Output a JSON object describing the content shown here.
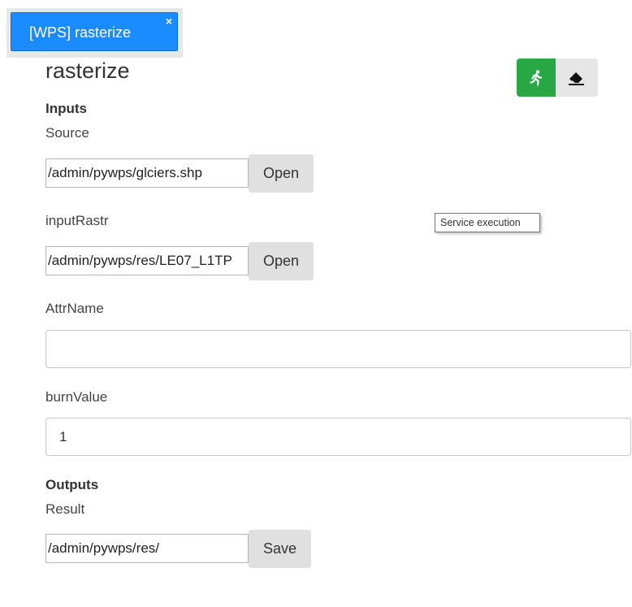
{
  "tab": {
    "label": "[WPS] rasterize",
    "close": "×"
  },
  "title": "rasterize",
  "actions": {
    "run_icon": "running-person-icon",
    "clear_icon": "eraser-icon",
    "tooltip": "Service execution"
  },
  "inputs": {
    "heading": "Inputs",
    "source": {
      "label": "Source",
      "value": "/admin/pywps/glciers.shp",
      "button": "Open"
    },
    "inputRastr": {
      "label": "inputRastr",
      "value": "/admin/pywps/res/LE07_L1TP",
      "button": "Open"
    },
    "attrName": {
      "label": "AttrName",
      "value": ""
    },
    "burnValue": {
      "label": "burnValue",
      "value": "1"
    }
  },
  "outputs": {
    "heading": "Outputs",
    "result": {
      "label": "Result",
      "value": "/admin/pywps/res/",
      "button": "Save"
    }
  },
  "colors": {
    "tab_bg": "#1a8cff",
    "run_bg": "#28a745",
    "clear_bg": "#e6e6e6",
    "button_bg": "#e0e0e0"
  }
}
